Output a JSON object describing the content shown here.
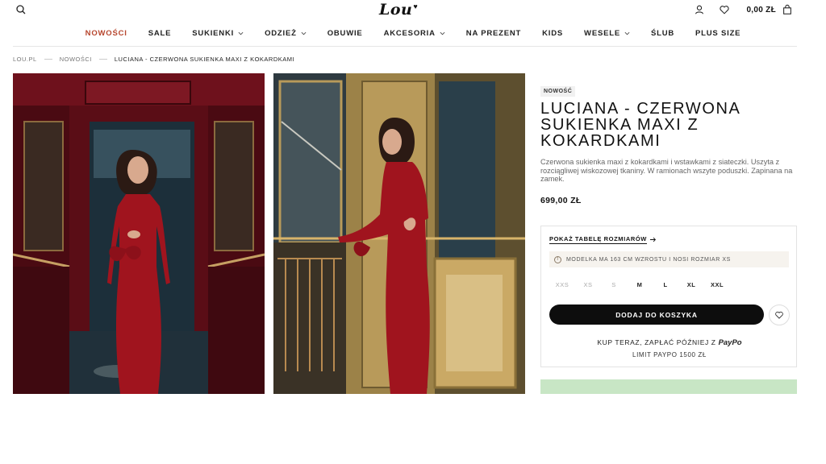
{
  "header": {
    "logo_text": "Lou",
    "cart_total": "0,00 ZŁ",
    "icons": {
      "search": "search-icon",
      "account": "user-icon",
      "wishlist": "heart-icon",
      "cart": "bag-icon"
    }
  },
  "nav": {
    "items": [
      {
        "label": "NOWOŚCI",
        "has_dropdown": false,
        "accent": true
      },
      {
        "label": "SALE",
        "has_dropdown": false
      },
      {
        "label": "SUKIENKI",
        "has_dropdown": true
      },
      {
        "label": "ODZIEŻ",
        "has_dropdown": true
      },
      {
        "label": "OBUWIE",
        "has_dropdown": false
      },
      {
        "label": "AKCESORIA",
        "has_dropdown": true
      },
      {
        "label": "NA PREZENT",
        "has_dropdown": false
      },
      {
        "label": "KIDS",
        "has_dropdown": false
      },
      {
        "label": "WESELE",
        "has_dropdown": true
      },
      {
        "label": "ŚLUB",
        "has_dropdown": false
      },
      {
        "label": "PLUS SIZE",
        "has_dropdown": false
      }
    ],
    "accent_color": "#b7462e"
  },
  "breadcrumb": [
    "LOU.PL",
    "NOWOŚCI",
    "LUCIANA - CZERWONA SUKIENKA MAXI Z KOKARDKAMI"
  ],
  "product": {
    "badge": "NOWOŚĆ",
    "title": "LUCIANA - CZERWONA SUKIENKA MAXI Z KOKARDKAMI",
    "description": "Czerwona sukienka maxi z kokardkami i wstawkami z siateczki. Uszyta z rozciągliwej wiskozowej tkaniny. W ramionach wszyte poduszki. Zapinana na zamek.",
    "price": "699,00 ZŁ",
    "dress_color": "#a0141e",
    "size_chart_link": "POKAŻ TABELĘ ROZMIARÓW",
    "model_info": "MODELKA MA 163 CM WZROSTU I NOSI ROZMIAR XS",
    "sizes": [
      {
        "label": "XXS",
        "available": false
      },
      {
        "label": "XS",
        "available": false
      },
      {
        "label": "S",
        "available": false
      },
      {
        "label": "M",
        "available": true
      },
      {
        "label": "L",
        "available": true
      },
      {
        "label": "XL",
        "available": true
      },
      {
        "label": "XXL",
        "available": true
      }
    ],
    "add_to_cart": "DODAJ DO KOSZYKA",
    "paypo_text": "KUP TERAZ, ZAPŁAĆ PÓŹNIEJ Z",
    "paypo_brand": "PayPo",
    "paypo_limit": "LIMIT PAYPO 1500 ZŁ"
  },
  "promo": {
    "background": "#c8e6c5"
  }
}
